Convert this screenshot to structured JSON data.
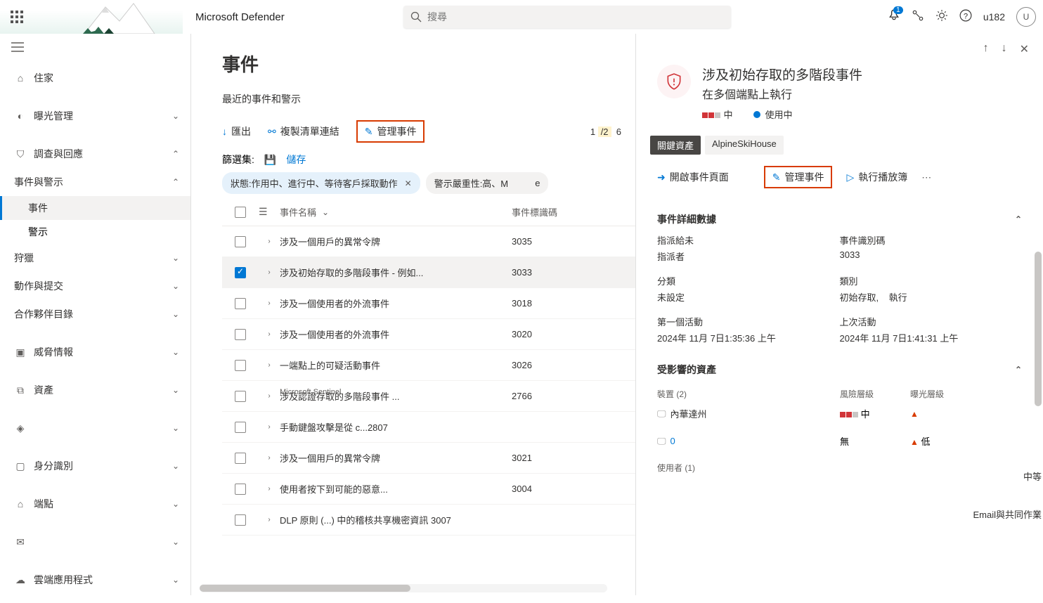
{
  "top": {
    "app_title": "Microsoft Defender",
    "search_placeholder": "搜尋",
    "bell_count": "1",
    "user_label": "u182",
    "avatar_initial": "U"
  },
  "nav": {
    "home": "住家",
    "exposure": "曝光管理",
    "investigate": "調查與回應",
    "incident_alerts": "事件與警示",
    "incidents": "事件",
    "alerts": "警示",
    "hunting": "狩獵",
    "actions": "動作與提交",
    "partner": "合作夥伴目錄",
    "threat_intel": "威脅情報",
    "assets": "資產",
    "sentinel": "",
    "identity": "身分識別",
    "endpoint": "端點",
    "email": "",
    "cloud_apps": "雲端應用程式"
  },
  "main": {
    "title": "事件",
    "recent_label": "最近的事件和警示",
    "export": "匯出",
    "copy_link": "複製清單連結",
    "manage": "管理事件",
    "pager_cur": "1",
    "pager_sep": "/2",
    "pager_total": "6",
    "filter_set": "篩選集:",
    "save": "儲存",
    "chip1": "狀態:作用中、進行中、等待客戶採取動作",
    "chip2": "警示嚴重性:高、M",
    "chip2_suffix": "e",
    "th_name": "事件名稱",
    "th_id": "事件標識碼",
    "sentinel_label": "Microsoft Sentinel",
    "rows": [
      {
        "name": "涉及一個用戶的異常令牌",
        "id": "3035",
        "checked": false
      },
      {
        "name": "涉及初始存取的多階段事件 - 例如...",
        "id": "3033",
        "checked": true
      },
      {
        "name": "涉及一個使用者的外流事件",
        "id": "3018",
        "checked": false
      },
      {
        "name": "涉及一個使用者的外流事件",
        "id": "3020",
        "checked": false
      },
      {
        "name": "一端點上的可疑活動事件",
        "id": "3026",
        "checked": false
      },
      {
        "name": "涉及認證存取的多階段事件 ...",
        "id": "2766",
        "checked": false
      },
      {
        "name": "手動鍵盤攻擊是從 c...2807",
        "id": "",
        "checked": false
      },
      {
        "name": "涉及一個用戶的異常令牌",
        "id": "3021",
        "checked": false
      },
      {
        "name": "使用者按下到可能的惡意...",
        "id": "3004",
        "checked": false
      },
      {
        "name": "DLP 原則 (...) 中的稽核共享機密資訊 3007",
        "id": "",
        "checked": false
      }
    ]
  },
  "panel": {
    "title_line1": "涉及初始存取的多階段事件",
    "title_line2": "在多個端點上執行",
    "severity": "中",
    "status": "使用中",
    "tab_active": "關鍵資產",
    "tab_inactive": "AlpineSkiHouse",
    "act_open": "開啟事件頁面",
    "act_manage": "管理事件",
    "act_playbook": "執行播放簿",
    "sec_details": "事件詳細數據",
    "assigned_lbl": "指派給未",
    "assigned_val": "指派者",
    "id_lbl": "事件識別碼",
    "id_val": "3033",
    "class_lbl": "分類",
    "class_val": "未設定",
    "cat_lbl": "類別",
    "cat_val1": "初始存取,",
    "cat_val2": "執行",
    "first_lbl": "第一個活動",
    "first_val": "2024年 11月 7日1:35:36 上午",
    "last_lbl": "上次活動",
    "last_val": "2024年 11月 7日1:41:31 上午",
    "sec_assets": "受影響的資產",
    "devices_lbl": "裝置 (2)",
    "col_risk": "風險層級",
    "col_exposure": "曝光層級",
    "dev1_name": "內華達州",
    "dev1_risk": "中",
    "dev2_name": "0",
    "dev2_risk": "無",
    "dev2_exp": "低",
    "edge_medium": "中等",
    "edge_email": "Email與共同作業",
    "users_lbl": "使用者 (1)"
  }
}
